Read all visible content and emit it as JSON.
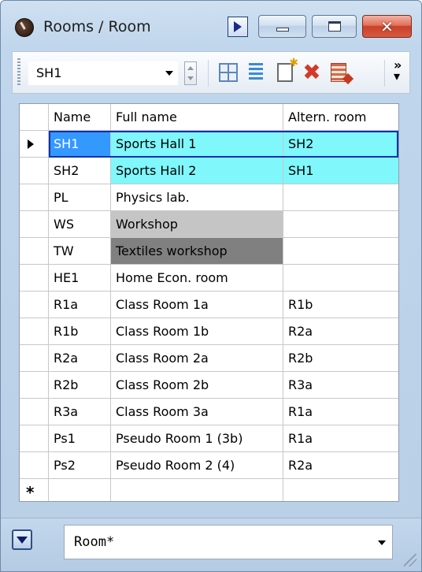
{
  "window": {
    "title": "Rooms / Room"
  },
  "titlebar": {
    "icon": "app-clock-icon",
    "nav_icon": "play-triangle-icon",
    "buttons": [
      "minimize",
      "maximize",
      "close"
    ],
    "close_glyph": "✕"
  },
  "toolbar": {
    "selector_value": "SH1",
    "overflow_label": "»",
    "icons": [
      "grid-icon",
      "list-lines-icon",
      "new-record-icon",
      "delete-icon",
      "edit-icon"
    ]
  },
  "grid": {
    "columns": [
      "Name",
      "Full name",
      "Altern. room"
    ],
    "rows": [
      {
        "name": "SH1",
        "full_name": "Sports Hall 1",
        "alt": "SH2",
        "state": "current"
      },
      {
        "name": "SH2",
        "full_name": "Sports Hall 2",
        "alt": "SH1",
        "state": "cyan"
      },
      {
        "name": "PL",
        "full_name": "Physics lab.",
        "alt": "",
        "state": "none"
      },
      {
        "name": "WS",
        "full_name": "Workshop",
        "alt": "",
        "state": "grey-light"
      },
      {
        "name": "TW",
        "full_name": "Textiles workshop",
        "alt": "",
        "state": "grey-dark"
      },
      {
        "name": "HE1",
        "full_name": "Home Econ. room",
        "alt": "",
        "state": "none"
      },
      {
        "name": "R1a",
        "full_name": "Class Room 1a",
        "alt": "R1b",
        "state": "none"
      },
      {
        "name": "R1b",
        "full_name": "Class Room 1b",
        "alt": "R2a",
        "state": "none"
      },
      {
        "name": "R2a",
        "full_name": "Class Room 2a",
        "alt": "R2b",
        "state": "none"
      },
      {
        "name": "R2b",
        "full_name": "Class Room 2b",
        "alt": "R3a",
        "state": "none"
      },
      {
        "name": "R3a",
        "full_name": "Class Room 3a",
        "alt": "R1a",
        "state": "none"
      },
      {
        "name": "Ps1",
        "full_name": "Pseudo Room 1 (3b)",
        "alt": "R1a",
        "state": "none"
      },
      {
        "name": "Ps2",
        "full_name": "Pseudo Room 2 (4)",
        "alt": "R2a",
        "state": "none"
      }
    ],
    "new_row_marker": "*"
  },
  "footer": {
    "filter_value": "Room*"
  },
  "colors": {
    "selection_blue": "#3399ff",
    "highlight_cyan": "#7ff7fb",
    "grey_light": "#c5c5c5",
    "grey_dark": "#808080"
  }
}
